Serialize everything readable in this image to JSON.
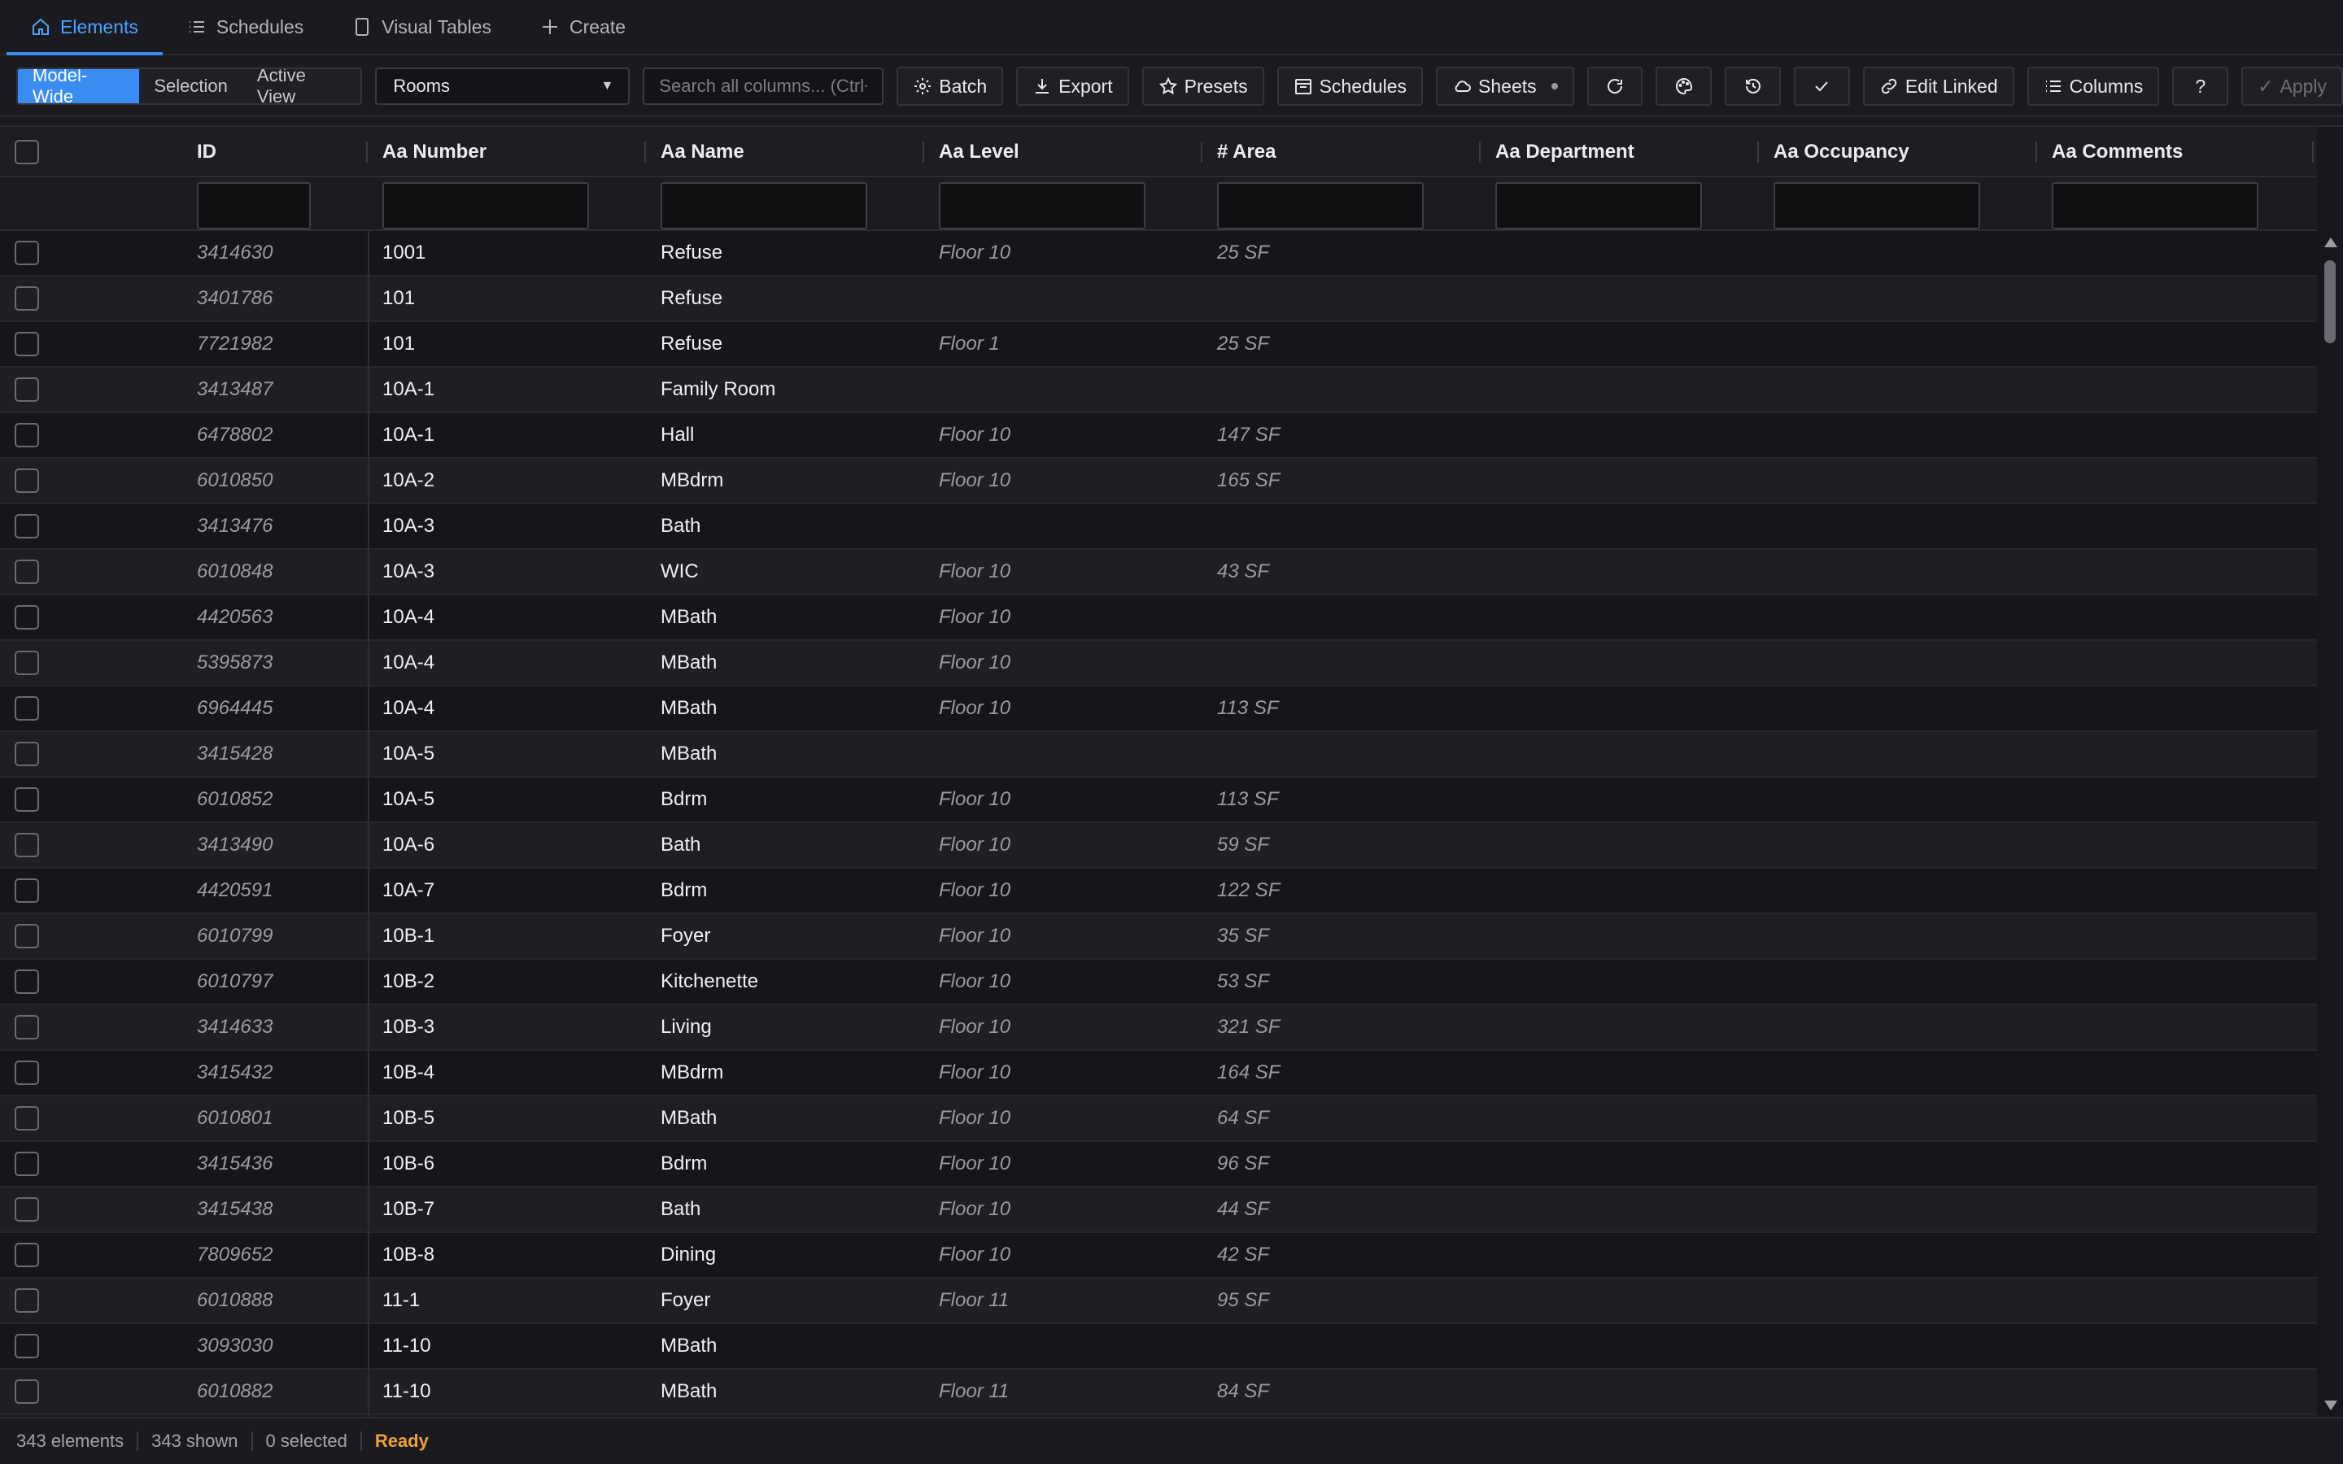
{
  "tabs": [
    {
      "label": "Elements",
      "icon": "home-icon",
      "active": true
    },
    {
      "label": "Schedules",
      "icon": "list-icon",
      "active": false
    },
    {
      "label": "Visual Tables",
      "icon": "tablet-icon",
      "active": false
    },
    {
      "label": "Create",
      "icon": "plus-icon",
      "active": false
    }
  ],
  "scope": {
    "options": [
      "Model-Wide",
      "Selection",
      "Active View"
    ],
    "selected": "Model-Wide"
  },
  "category_select": {
    "value": "Rooms"
  },
  "search": {
    "placeholder": "Search all columns... (Ctrl+F)"
  },
  "toolbar": {
    "batch_label": "Batch",
    "export_label": "Export",
    "presets_label": "Presets",
    "schedules_label": "Schedules",
    "sheets_label": "Sheets",
    "edit_linked_label": "Edit Linked",
    "columns_label": "Columns",
    "help_label": "?",
    "apply_label": "Apply"
  },
  "columns": [
    {
      "label": "ID"
    },
    {
      "label": "Aa Number"
    },
    {
      "label": "Aa Name"
    },
    {
      "label": "Aa Level"
    },
    {
      "label": "# Area"
    },
    {
      "label": "Aa Department"
    },
    {
      "label": "Aa Occupancy"
    },
    {
      "label": "Aa Comments"
    }
  ],
  "rows": [
    {
      "id": "3414630",
      "number": "1001",
      "name": "Refuse",
      "level": "Floor 10",
      "area": "25 SF"
    },
    {
      "id": "3401786",
      "number": "101",
      "name": "Refuse",
      "level": "",
      "area": ""
    },
    {
      "id": "7721982",
      "number": "101",
      "name": "Refuse",
      "level": "Floor 1",
      "area": "25 SF"
    },
    {
      "id": "3413487",
      "number": "10A-1",
      "name": "Family Room",
      "level": "",
      "area": ""
    },
    {
      "id": "6478802",
      "number": "10A-1",
      "name": "Hall",
      "level": "Floor 10",
      "area": "147 SF"
    },
    {
      "id": "6010850",
      "number": "10A-2",
      "name": "MBdrm",
      "level": "Floor 10",
      "area": "165 SF"
    },
    {
      "id": "3413476",
      "number": "10A-3",
      "name": "Bath",
      "level": "",
      "area": ""
    },
    {
      "id": "6010848",
      "number": "10A-3",
      "name": "WIC",
      "level": "Floor 10",
      "area": "43 SF"
    },
    {
      "id": "4420563",
      "number": "10A-4",
      "name": "MBath",
      "level": "Floor 10",
      "area": ""
    },
    {
      "id": "5395873",
      "number": "10A-4",
      "name": "MBath",
      "level": "Floor 10",
      "area": ""
    },
    {
      "id": "6964445",
      "number": "10A-4",
      "name": "MBath",
      "level": "Floor 10",
      "area": "113 SF"
    },
    {
      "id": "3415428",
      "number": "10A-5",
      "name": "MBath",
      "level": "",
      "area": ""
    },
    {
      "id": "6010852",
      "number": "10A-5",
      "name": "Bdrm",
      "level": "Floor 10",
      "area": "113 SF"
    },
    {
      "id": "3413490",
      "number": "10A-6",
      "name": "Bath",
      "level": "Floor 10",
      "area": "59 SF"
    },
    {
      "id": "4420591",
      "number": "10A-7",
      "name": "Bdrm",
      "level": "Floor 10",
      "area": "122 SF"
    },
    {
      "id": "6010799",
      "number": "10B-1",
      "name": "Foyer",
      "level": "Floor 10",
      "area": "35 SF"
    },
    {
      "id": "6010797",
      "number": "10B-2",
      "name": "Kitchenette",
      "level": "Floor 10",
      "area": "53 SF"
    },
    {
      "id": "3414633",
      "number": "10B-3",
      "name": "Living",
      "level": "Floor 10",
      "area": "321 SF"
    },
    {
      "id": "3415432",
      "number": "10B-4",
      "name": "MBdrm",
      "level": "Floor 10",
      "area": "164 SF"
    },
    {
      "id": "6010801",
      "number": "10B-5",
      "name": "MBath",
      "level": "Floor 10",
      "area": "64 SF"
    },
    {
      "id": "3415436",
      "number": "10B-6",
      "name": "Bdrm",
      "level": "Floor 10",
      "area": "96 SF"
    },
    {
      "id": "3415438",
      "number": "10B-7",
      "name": "Bath",
      "level": "Floor 10",
      "area": "44 SF"
    },
    {
      "id": "7809652",
      "number": "10B-8",
      "name": "Dining",
      "level": "Floor 10",
      "area": "42 SF"
    },
    {
      "id": "6010888",
      "number": "11-1",
      "name": "Foyer",
      "level": "Floor 11",
      "area": "95 SF"
    },
    {
      "id": "3093030",
      "number": "11-10",
      "name": "MBath",
      "level": "",
      "area": ""
    },
    {
      "id": "6010882",
      "number": "11-10",
      "name": "MBath",
      "level": "Floor 11",
      "area": "84 SF"
    }
  ],
  "status": {
    "elements": "343 elements",
    "shown": "343 shown",
    "selected": "0 selected",
    "state": "Ready"
  },
  "colors": {
    "accent": "#3b8cf0",
    "background": "#1b1b1f",
    "status_ready": "#f0a23a"
  }
}
